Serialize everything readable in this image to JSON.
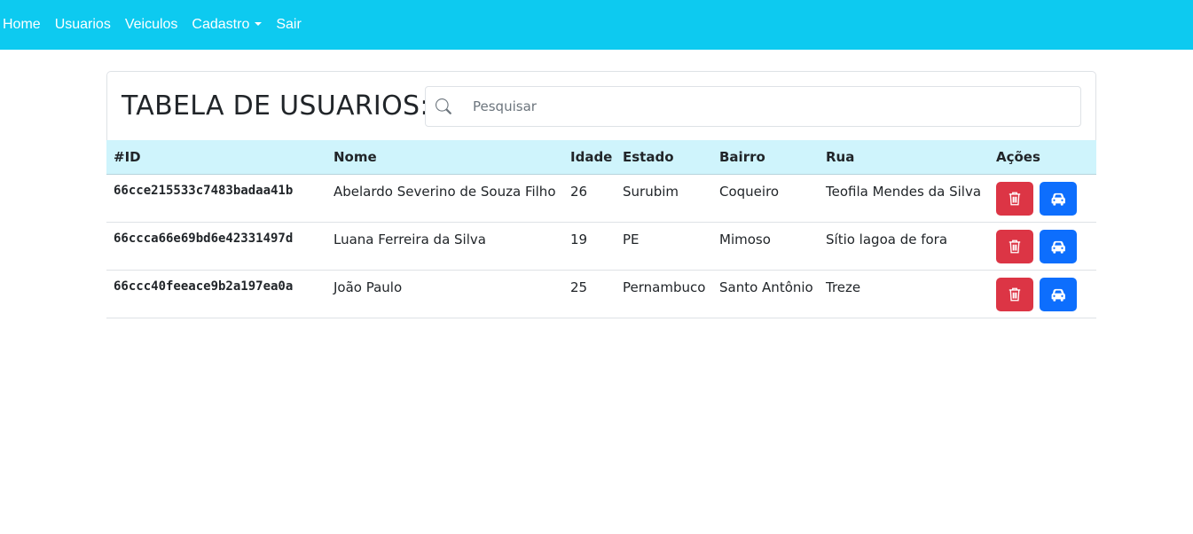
{
  "nav": {
    "items": [
      {
        "label": "Home"
      },
      {
        "label": "Usuarios"
      },
      {
        "label": "Veiculos"
      },
      {
        "label": "Cadastro"
      },
      {
        "label": "Sair"
      }
    ]
  },
  "header": {
    "title": "TABELA DE USUARIOS:",
    "search": {
      "placeholder": "Pesquisar",
      "value": ""
    }
  },
  "table": {
    "columns": [
      "#ID",
      "Nome",
      "Idade",
      "Estado",
      "Bairro",
      "Rua",
      "Ações"
    ],
    "rows": [
      {
        "id": "66cce215533c7483badaa41b",
        "nome": "Abelardo Severino de Souza Filho",
        "idade": "26",
        "estado": "Surubim",
        "bairro": "Coqueiro",
        "rua": "Teofila Mendes da Silva"
      },
      {
        "id": "66ccca66e69bd6e42331497d",
        "nome": "Luana Ferreira da Silva",
        "idade": "19",
        "estado": "PE",
        "bairro": "Mimoso",
        "rua": "Sítio lagoa de fora"
      },
      {
        "id": "66ccc40feeace9b2a197ea0a",
        "nome": "João Paulo",
        "idade": "25",
        "estado": "Pernambuco",
        "bairro": "Santo Antônio",
        "rua": "Treze"
      }
    ]
  },
  "icons": {
    "delete": "trash-icon",
    "vehicle": "car-icon",
    "search": "search-icon"
  },
  "colors": {
    "navbar": "#0dcaf0",
    "table_header": "#cff4fc",
    "danger": "#dc3545",
    "primary": "#0d6efd"
  }
}
